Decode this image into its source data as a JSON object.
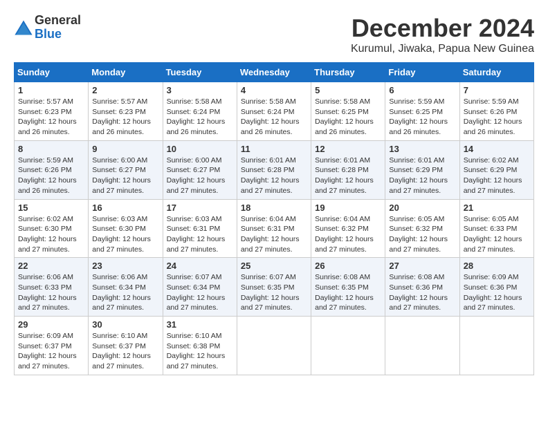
{
  "logo": {
    "line1": "General",
    "line2": "Blue"
  },
  "title": "December 2024",
  "location": "Kurumul, Jiwaka, Papua New Guinea",
  "days_of_week": [
    "Sunday",
    "Monday",
    "Tuesday",
    "Wednesday",
    "Thursday",
    "Friday",
    "Saturday"
  ],
  "weeks": [
    [
      {
        "day": "1",
        "info": "Sunrise: 5:57 AM\nSunset: 6:23 PM\nDaylight: 12 hours\nand 26 minutes."
      },
      {
        "day": "2",
        "info": "Sunrise: 5:57 AM\nSunset: 6:23 PM\nDaylight: 12 hours\nand 26 minutes."
      },
      {
        "day": "3",
        "info": "Sunrise: 5:58 AM\nSunset: 6:24 PM\nDaylight: 12 hours\nand 26 minutes."
      },
      {
        "day": "4",
        "info": "Sunrise: 5:58 AM\nSunset: 6:24 PM\nDaylight: 12 hours\nand 26 minutes."
      },
      {
        "day": "5",
        "info": "Sunrise: 5:58 AM\nSunset: 6:25 PM\nDaylight: 12 hours\nand 26 minutes."
      },
      {
        "day": "6",
        "info": "Sunrise: 5:59 AM\nSunset: 6:25 PM\nDaylight: 12 hours\nand 26 minutes."
      },
      {
        "day": "7",
        "info": "Sunrise: 5:59 AM\nSunset: 6:26 PM\nDaylight: 12 hours\nand 26 minutes."
      }
    ],
    [
      {
        "day": "8",
        "info": "Sunrise: 5:59 AM\nSunset: 6:26 PM\nDaylight: 12 hours\nand 26 minutes."
      },
      {
        "day": "9",
        "info": "Sunrise: 6:00 AM\nSunset: 6:27 PM\nDaylight: 12 hours\nand 27 minutes."
      },
      {
        "day": "10",
        "info": "Sunrise: 6:00 AM\nSunset: 6:27 PM\nDaylight: 12 hours\nand 27 minutes."
      },
      {
        "day": "11",
        "info": "Sunrise: 6:01 AM\nSunset: 6:28 PM\nDaylight: 12 hours\nand 27 minutes."
      },
      {
        "day": "12",
        "info": "Sunrise: 6:01 AM\nSunset: 6:28 PM\nDaylight: 12 hours\nand 27 minutes."
      },
      {
        "day": "13",
        "info": "Sunrise: 6:01 AM\nSunset: 6:29 PM\nDaylight: 12 hours\nand 27 minutes."
      },
      {
        "day": "14",
        "info": "Sunrise: 6:02 AM\nSunset: 6:29 PM\nDaylight: 12 hours\nand 27 minutes."
      }
    ],
    [
      {
        "day": "15",
        "info": "Sunrise: 6:02 AM\nSunset: 6:30 PM\nDaylight: 12 hours\nand 27 minutes."
      },
      {
        "day": "16",
        "info": "Sunrise: 6:03 AM\nSunset: 6:30 PM\nDaylight: 12 hours\nand 27 minutes."
      },
      {
        "day": "17",
        "info": "Sunrise: 6:03 AM\nSunset: 6:31 PM\nDaylight: 12 hours\nand 27 minutes."
      },
      {
        "day": "18",
        "info": "Sunrise: 6:04 AM\nSunset: 6:31 PM\nDaylight: 12 hours\nand 27 minutes."
      },
      {
        "day": "19",
        "info": "Sunrise: 6:04 AM\nSunset: 6:32 PM\nDaylight: 12 hours\nand 27 minutes."
      },
      {
        "day": "20",
        "info": "Sunrise: 6:05 AM\nSunset: 6:32 PM\nDaylight: 12 hours\nand 27 minutes."
      },
      {
        "day": "21",
        "info": "Sunrise: 6:05 AM\nSunset: 6:33 PM\nDaylight: 12 hours\nand 27 minutes."
      }
    ],
    [
      {
        "day": "22",
        "info": "Sunrise: 6:06 AM\nSunset: 6:33 PM\nDaylight: 12 hours\nand 27 minutes."
      },
      {
        "day": "23",
        "info": "Sunrise: 6:06 AM\nSunset: 6:34 PM\nDaylight: 12 hours\nand 27 minutes."
      },
      {
        "day": "24",
        "info": "Sunrise: 6:07 AM\nSunset: 6:34 PM\nDaylight: 12 hours\nand 27 minutes."
      },
      {
        "day": "25",
        "info": "Sunrise: 6:07 AM\nSunset: 6:35 PM\nDaylight: 12 hours\nand 27 minutes."
      },
      {
        "day": "26",
        "info": "Sunrise: 6:08 AM\nSunset: 6:35 PM\nDaylight: 12 hours\nand 27 minutes."
      },
      {
        "day": "27",
        "info": "Sunrise: 6:08 AM\nSunset: 6:36 PM\nDaylight: 12 hours\nand 27 minutes."
      },
      {
        "day": "28",
        "info": "Sunrise: 6:09 AM\nSunset: 6:36 PM\nDaylight: 12 hours\nand 27 minutes."
      }
    ],
    [
      {
        "day": "29",
        "info": "Sunrise: 6:09 AM\nSunset: 6:37 PM\nDaylight: 12 hours\nand 27 minutes."
      },
      {
        "day": "30",
        "info": "Sunrise: 6:10 AM\nSunset: 6:37 PM\nDaylight: 12 hours\nand 27 minutes."
      },
      {
        "day": "31",
        "info": "Sunrise: 6:10 AM\nSunset: 6:38 PM\nDaylight: 12 hours\nand 27 minutes."
      },
      {
        "day": "",
        "info": ""
      },
      {
        "day": "",
        "info": ""
      },
      {
        "day": "",
        "info": ""
      },
      {
        "day": "",
        "info": ""
      }
    ]
  ]
}
